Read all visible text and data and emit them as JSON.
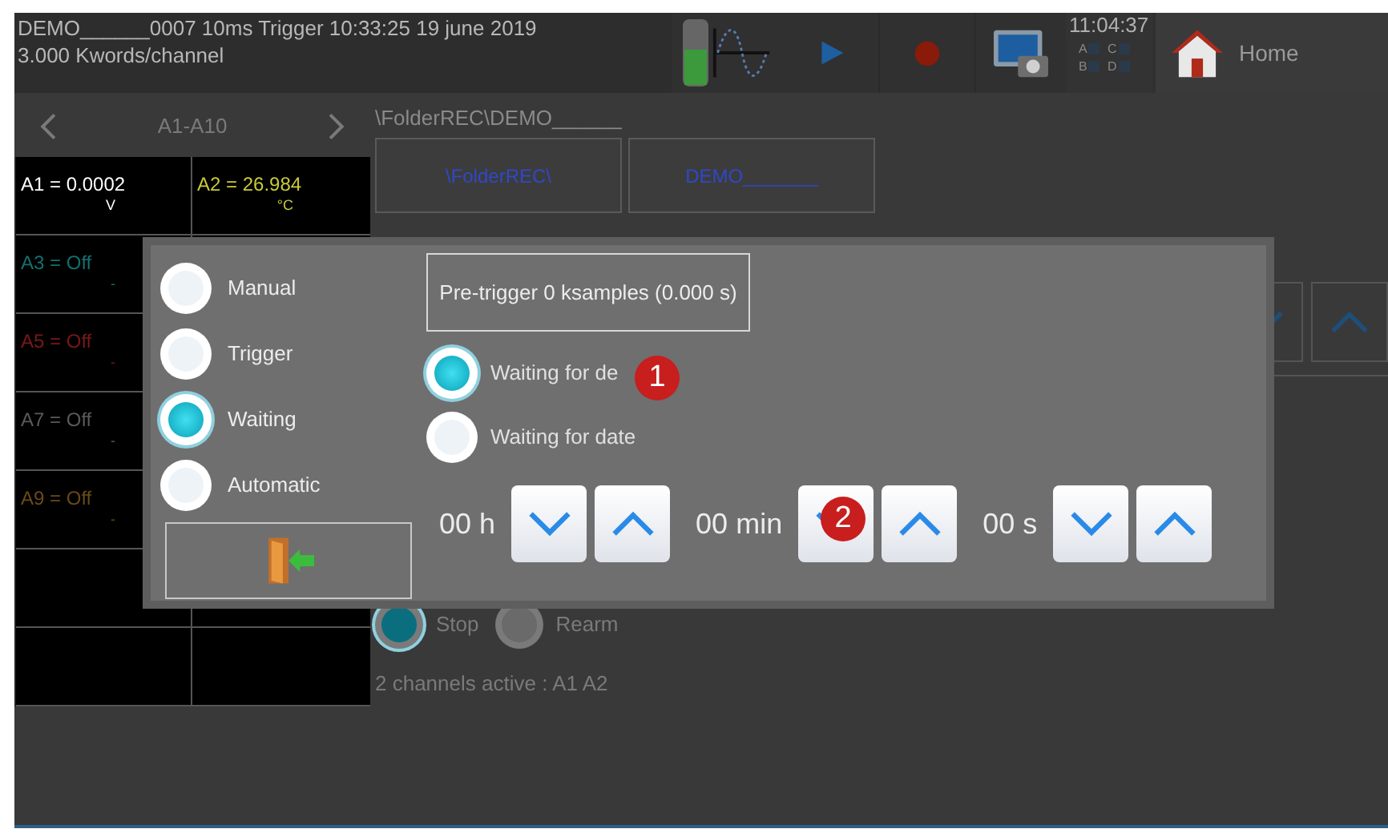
{
  "header": {
    "title": "DEMO______0007  10ms  Trigger 10:33:25 19 june 2019",
    "subtitle": "3.000 Kwords/channel",
    "level": 0.55,
    "clock": {
      "time": "11:04:37",
      "indicators": [
        {
          "label": "A",
          "on": false
        },
        {
          "label": "C",
          "on": false
        },
        {
          "label": "B",
          "on": false
        },
        {
          "label": "D",
          "on": false
        }
      ]
    },
    "home": "Home"
  },
  "nav": {
    "label": "A1-A10"
  },
  "path": "\\FolderREC\\DEMO______",
  "folder_buttons": [
    "\\FolderREC\\",
    "DEMO_______"
  ],
  "channel_rows": [
    {
      "cells": [
        {
          "text": "A1 = 0.0002",
          "unit": "V",
          "color": "#ffffff"
        },
        {
          "text": "A2 = 26.984",
          "unit": "°C",
          "color": "#c9c93a"
        }
      ]
    },
    {
      "cells": [
        {
          "text": "A3 = Off",
          "unit": "-",
          "color": "#137070"
        }
      ]
    },
    {
      "cells": [
        {
          "text": "A5 = Off",
          "unit": "-",
          "color": "#7a1818"
        }
      ]
    },
    {
      "cells": [
        {
          "text": "A7 = Off",
          "unit": "-",
          "color": "#5a5a5a"
        }
      ]
    },
    {
      "cells": [
        {
          "text": "A9 = Off",
          "unit": "-",
          "color": "#6a4a18"
        }
      ]
    }
  ],
  "stop_modes": [
    {
      "label": "Stop",
      "selected": true
    },
    {
      "label": "Rearm",
      "selected": false
    }
  ],
  "status": "2 channels active : A1 A2",
  "dialog": {
    "modes": [
      {
        "label": "Manual",
        "selected": false
      },
      {
        "label": "Trigger",
        "selected": false
      },
      {
        "label": "Waiting",
        "selected": true
      },
      {
        "label": "Automatic",
        "selected": false
      }
    ],
    "pretrigger": "Pre-trigger 0 ksamples (0.000 s)",
    "wait_options": [
      {
        "label": "Waiting for de",
        "selected": true
      },
      {
        "label": "Waiting for date",
        "selected": false
      }
    ],
    "time_fields": [
      "00 h",
      "00 min",
      "00 s"
    ],
    "annotations": [
      "1",
      "2"
    ]
  }
}
